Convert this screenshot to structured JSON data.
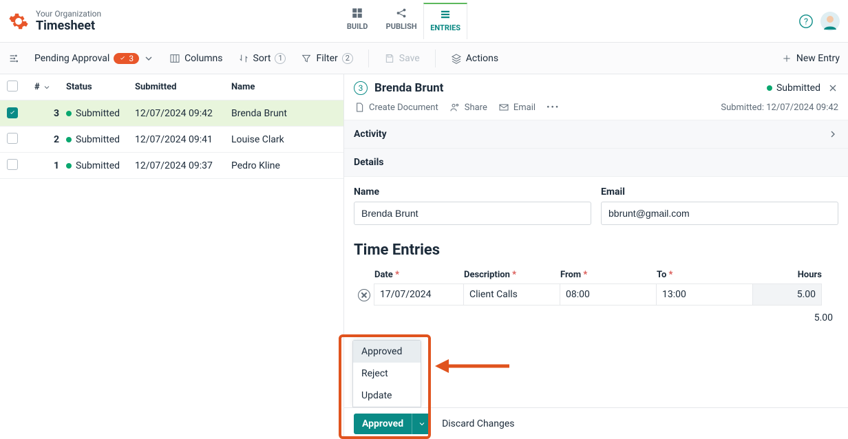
{
  "header": {
    "org": "Your Organization",
    "page": "Timesheet",
    "tabs": {
      "build": "BUILD",
      "publish": "PUBLISH",
      "entries": "ENTRIES"
    }
  },
  "toolbar": {
    "view_name": "Pending Approval",
    "pending_count": "3",
    "columns": "Columns",
    "sort": "Sort",
    "sort_count": "1",
    "filter": "Filter",
    "filter_count": "2",
    "save": "Save",
    "actions": "Actions",
    "new_entry": "New Entry"
  },
  "grid": {
    "head": {
      "idx": "#",
      "status": "Status",
      "submitted": "Submitted",
      "name": "Name"
    },
    "rows": [
      {
        "idx": "3",
        "status": "Submitted",
        "submitted": "12/07/2024 09:42",
        "name": "Brenda Brunt",
        "selected": true
      },
      {
        "idx": "2",
        "status": "Submitted",
        "submitted": "12/07/2024 09:41",
        "name": "Louise Clark",
        "selected": false
      },
      {
        "idx": "1",
        "status": "Submitted",
        "submitted": "12/07/2024 09:37",
        "name": "Pedro Kline",
        "selected": false
      }
    ]
  },
  "panel": {
    "index": "3",
    "title": "Brenda Brunt",
    "status": "Submitted",
    "actions": {
      "create_doc": "Create Document",
      "share": "Share",
      "email": "Email"
    },
    "submitted_label": "Submitted:",
    "submitted_value": "12/07/2024 09:42",
    "section_activity": "Activity",
    "section_details": "Details",
    "fields": {
      "name_label": "Name",
      "name_value": "Brenda Brunt",
      "email_label": "Email",
      "email_value": "bbrunt@gmail.com"
    },
    "time_entries_title": "Time Entries",
    "te_head": {
      "date": "Date",
      "desc": "Description",
      "from": "From",
      "to": "To",
      "hours": "Hours"
    },
    "te_rows": [
      {
        "date": "17/07/2024",
        "desc": "Client Calls",
        "from": "08:00",
        "to": "13:00",
        "hours": "5.00"
      }
    ],
    "total_hours": "5.00"
  },
  "footer": {
    "approved": "Approved",
    "discard": "Discard Changes",
    "menu": {
      "approved": "Approved",
      "reject": "Reject",
      "update": "Update"
    }
  }
}
